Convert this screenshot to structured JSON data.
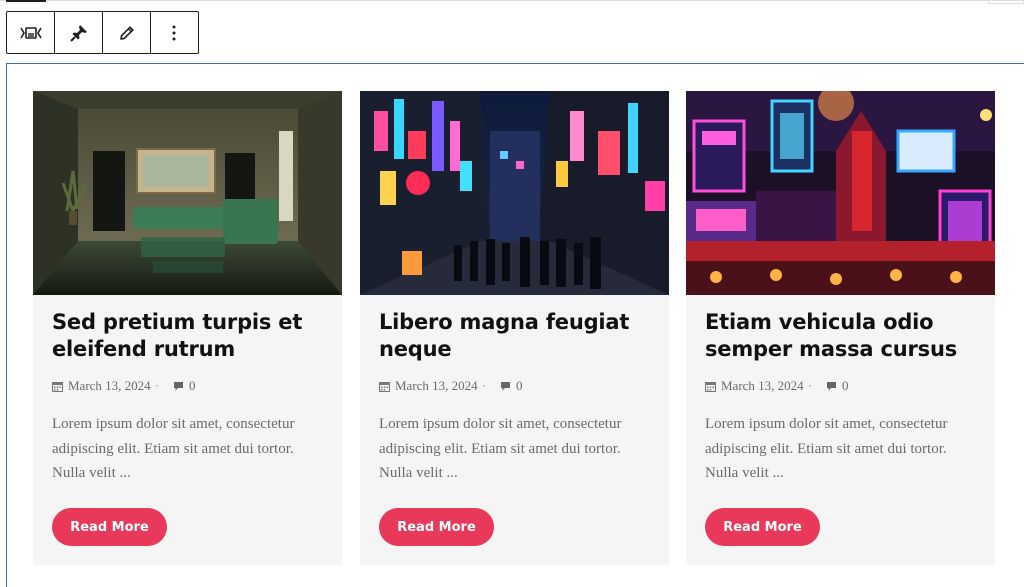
{
  "toolbar": {
    "buttons": [
      {
        "name": "block-type-icon"
      },
      {
        "name": "pin-icon"
      },
      {
        "name": "pencil-icon"
      },
      {
        "name": "more-options-icon"
      }
    ]
  },
  "posts": [
    {
      "title": "Sed pretium turpis et eleifend rutrum",
      "date": "March 13, 2024",
      "comments": "0",
      "excerpt": "Lorem ipsum dolor sit amet, consectetur adipiscing elit. Etiam sit amet dui tortor. Nulla velit ...",
      "button": "Read More"
    },
    {
      "title": "Libero magna feugiat neque",
      "date": "March 13, 2024",
      "comments": "0",
      "excerpt": "Lorem ipsum dolor sit amet, consectetur adipiscing elit. Etiam sit amet dui tortor. Nulla velit ...",
      "button": "Read More"
    },
    {
      "title": "Etiam vehicula odio semper massa cursus",
      "date": "March 13, 2024",
      "comments": "0",
      "excerpt": "Lorem ipsum dolor sit amet, consectetur adipiscing elit. Etiam sit amet dui tortor. Nulla velit ...",
      "button": "Read More"
    }
  ],
  "colors": {
    "accent": "#e8395a",
    "card_bg": "#f5f5f5",
    "selection": "#3f6fb5"
  }
}
